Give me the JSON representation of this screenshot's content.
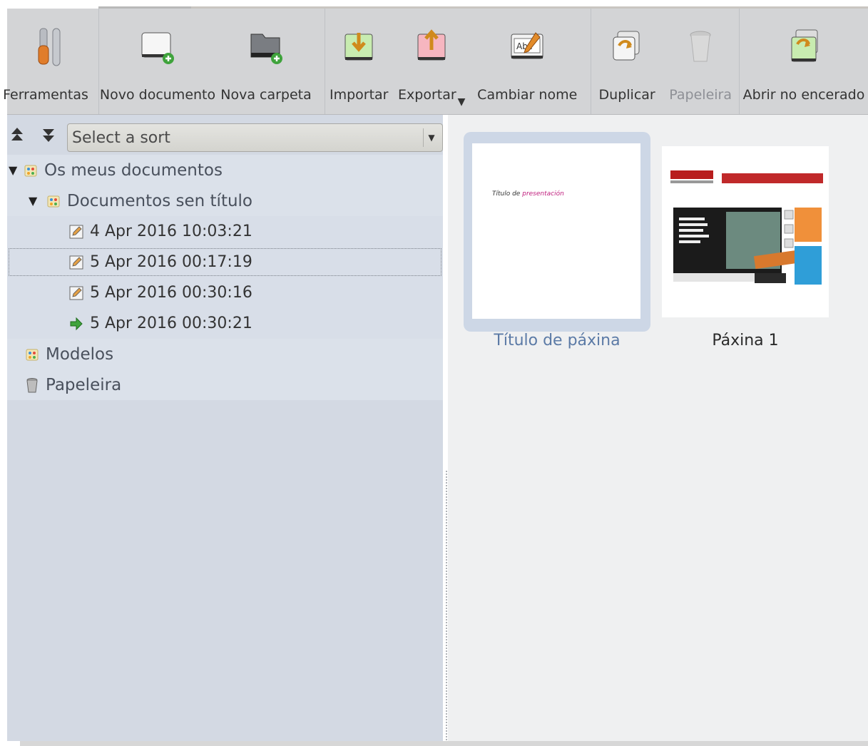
{
  "toolbar": {
    "buttons": [
      {
        "label": "Ferramentas",
        "icon": "tools-icon",
        "enabled": true
      },
      {
        "label": "Novo documento",
        "icon": "new-document-icon",
        "enabled": true
      },
      {
        "label": "Nova carpeta",
        "icon": "new-folder-icon",
        "enabled": true
      },
      {
        "label": "Importar",
        "icon": "import-icon",
        "enabled": true
      },
      {
        "label": "Exportar",
        "icon": "export-icon",
        "enabled": true
      },
      {
        "label": "Cambiar nome",
        "icon": "rename-icon",
        "enabled": true
      },
      {
        "label": "Duplicar",
        "icon": "duplicate-icon",
        "enabled": true
      },
      {
        "label": "Papeleira",
        "icon": "trash-icon",
        "enabled": false
      },
      {
        "label": "Abrir no encerado",
        "icon": "open-in-board-icon",
        "enabled": true
      }
    ]
  },
  "sort": {
    "placeholder": "Select a sort",
    "up_icon": "sort-ascending-icon",
    "down_icon": "sort-descending-icon"
  },
  "tree": {
    "root": "Os meus documentos",
    "folder": "Documentos sen título",
    "items": [
      "4 Apr 2016 10:03:21",
      "5 Apr 2016 00:17:19",
      "5 Apr 2016 00:30:16",
      "5 Apr 2016 00:30:21"
    ],
    "models": "Modelos",
    "trash": "Papeleira"
  },
  "pages": {
    "page1_caption": "Título de páxina",
    "page1_thumb_text": "Título de",
    "page1_thumb_text_accent": "presentación",
    "page2_caption": "Páxina 1"
  },
  "colors": {
    "toolbar_bg": "#d3d4d6",
    "tree_bg": "#d3d9e3",
    "selected_caption": "#5b7aa6",
    "accent_pink": "#c0207e"
  }
}
